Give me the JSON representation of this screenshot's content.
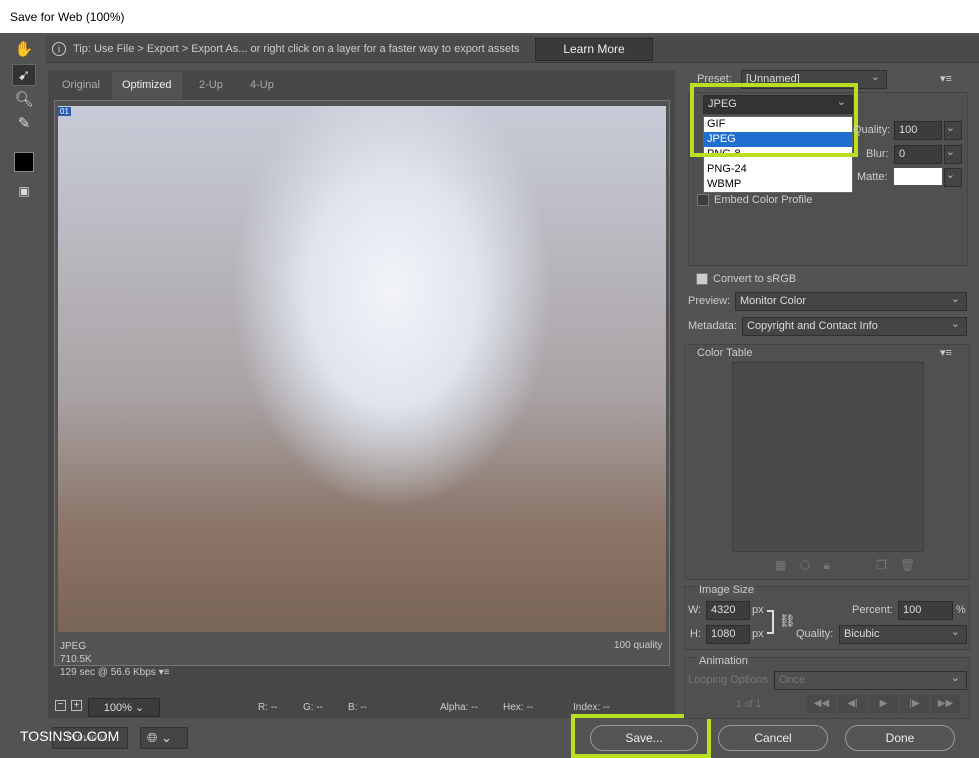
{
  "window": {
    "title": "Save for Web (100%)"
  },
  "tipbar": {
    "tip": "Tip: Use File > Export > Export As...  or right click on a layer for a faster way to export assets",
    "learn_more": "Learn More"
  },
  "tabs": [
    {
      "label": "Original"
    },
    {
      "label": "Optimized",
      "active": true
    },
    {
      "label": "2-Up"
    },
    {
      "label": "4-Up"
    }
  ],
  "image_info": {
    "badge": "01",
    "format": "JPEG",
    "size": "710.5K",
    "time": "129 sec @ 56.6 Kbps",
    "quality": "100 quality"
  },
  "statusbar": {
    "zoom": "100%",
    "r": "R: --",
    "g": "G: --",
    "b": "B: --",
    "alpha": "Alpha: --",
    "hex": "Hex: --",
    "index": "Index: --"
  },
  "settings": {
    "preset_label": "Preset:",
    "preset_value": "[Unnamed]",
    "format_value": "JPEG",
    "format_options": [
      "GIF",
      "JPEG",
      "PNG-8",
      "PNG-24",
      "WBMP"
    ],
    "format_selected": "JPEG",
    "quality_label": "Quality:",
    "quality_value": "100",
    "blur_label": "Blur:",
    "blur_value": "0",
    "matte_label": "Matte:",
    "embed_color_profile": "Embed Color Profile",
    "embed_checked": false,
    "convert_srgb": "Convert to sRGB",
    "convert_checked": true,
    "preview_label": "Preview:",
    "preview_value": "Monitor Color",
    "metadata_label": "Metadata:",
    "metadata_value": "Copyright and Contact Info"
  },
  "color_table": {
    "title": "Color Table"
  },
  "image_size": {
    "title": "Image Size",
    "w_label": "W:",
    "w_value": "4320",
    "h_label": "H:",
    "h_value": "1080",
    "unit": "px",
    "percent_label": "Percent:",
    "percent_value": "100",
    "percent_unit": "%",
    "quality_label": "Quality:",
    "quality_value": "Bicubic"
  },
  "animation": {
    "title": "Animation",
    "looping_label": "Looping Options:",
    "looping_value": "Once",
    "frame": "1 of 1"
  },
  "buttons": {
    "preview": "Preview...",
    "save": "Save...",
    "cancel": "Cancel",
    "done": "Done"
  },
  "watermark": "TOSINSO.COM",
  "colors": {
    "highlight": "#b8e021",
    "selection": "#1e6fd0",
    "bg": "#535353"
  }
}
